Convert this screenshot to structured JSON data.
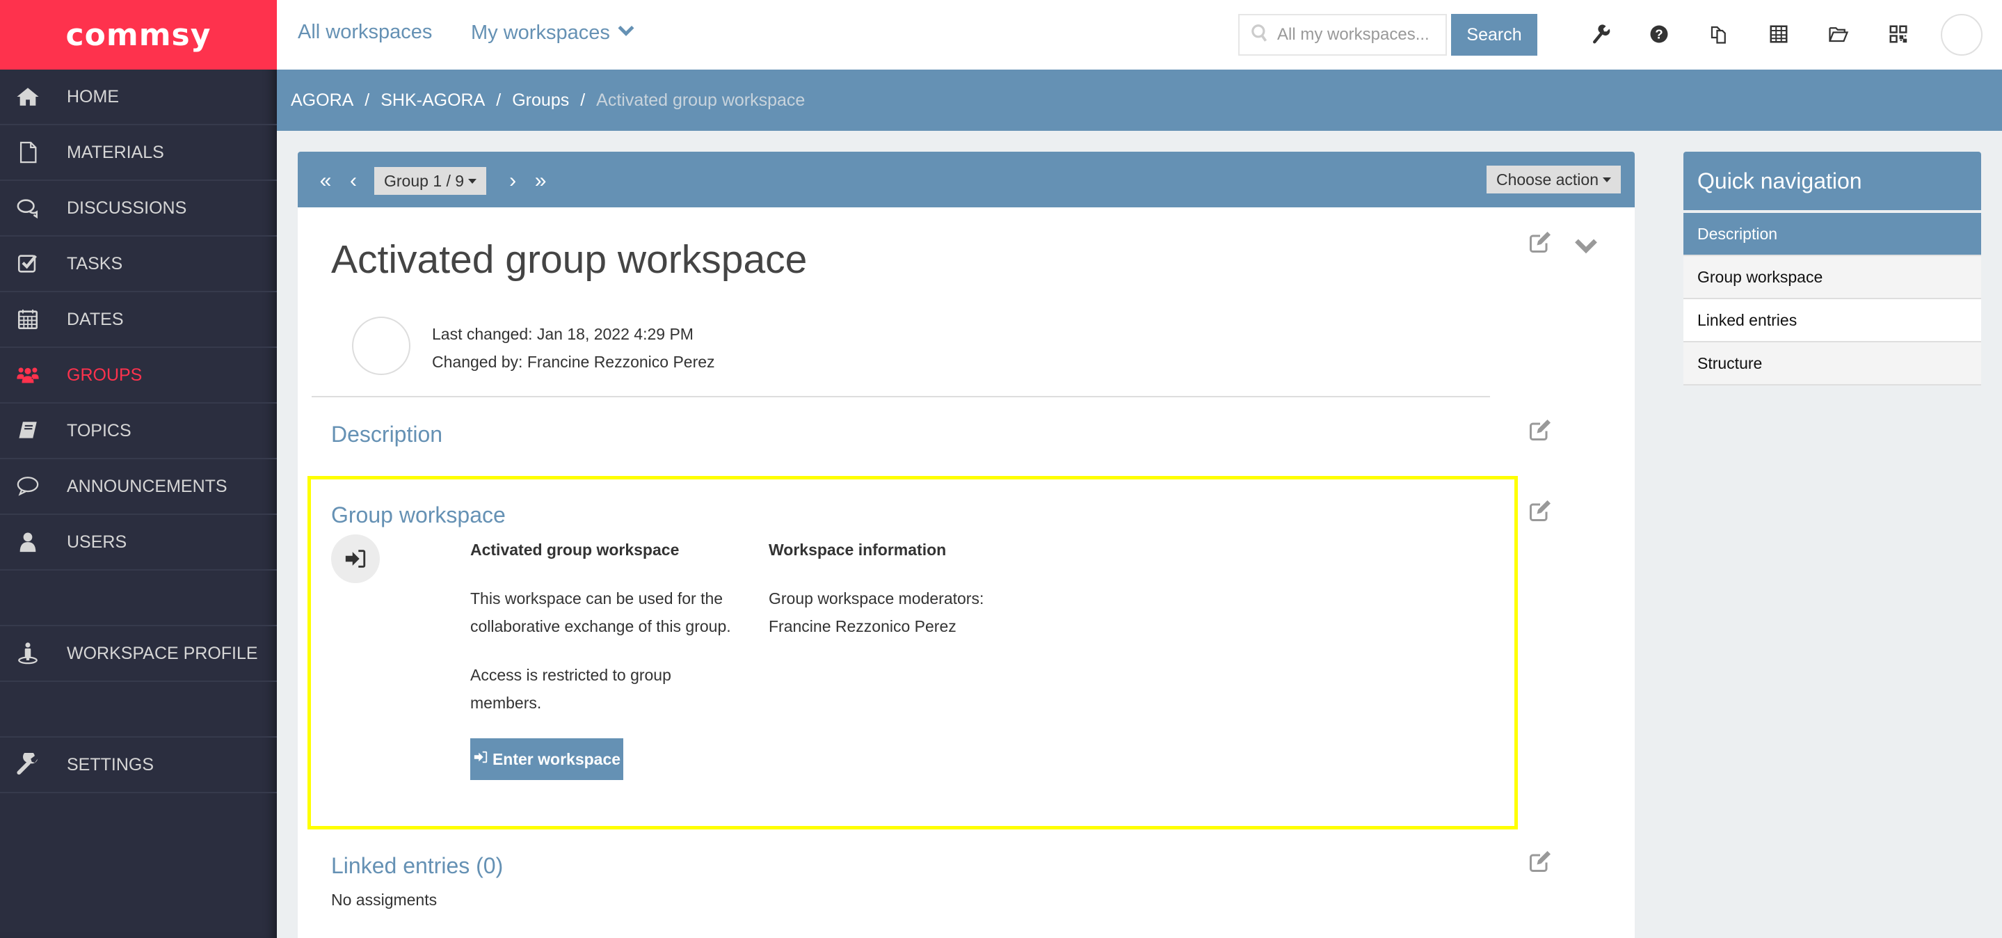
{
  "app": {
    "logo_text": "commsy",
    "brand_color": "#fe324d",
    "accent_color": "#6591b4"
  },
  "sidebar": {
    "items": [
      {
        "label": "HOME",
        "icon": "home-icon",
        "active": false
      },
      {
        "label": "MATERIALS",
        "icon": "file-icon",
        "active": false
      },
      {
        "label": "DISCUSSIONS",
        "icon": "comments-icon",
        "active": false
      },
      {
        "label": "TASKS",
        "icon": "checkbox-icon",
        "active": false
      },
      {
        "label": "DATES",
        "icon": "calendar-icon",
        "active": false
      },
      {
        "label": "GROUPS",
        "icon": "users-icon",
        "active": true
      },
      {
        "label": "TOPICS",
        "icon": "book-icon",
        "active": false
      },
      {
        "label": "ANNOUNCEMENTS",
        "icon": "speech-bubble-icon",
        "active": false
      },
      {
        "label": "USERS",
        "icon": "user-icon",
        "active": false
      },
      {
        "label": "WORKSPACE PROFILE",
        "icon": "street-view-icon",
        "active": false
      },
      {
        "label": "SETTINGS",
        "icon": "wrench-icon",
        "active": false
      }
    ]
  },
  "topbar": {
    "all_workspaces": "All workspaces",
    "my_workspaces": "My workspaces",
    "search_placeholder": "All my workspaces...",
    "search_button": "Search",
    "tools": [
      "wrench-icon",
      "help-icon",
      "copy-icon",
      "table-icon",
      "folder-open-icon",
      "qrcode-icon"
    ]
  },
  "breadcrumb": {
    "items": [
      "AGORA",
      "SHK-AGORA",
      "Groups"
    ],
    "current": "Activated group workspace",
    "separator": "/"
  },
  "toolbar": {
    "pager_label": "Group 1 / 9",
    "first_label": "«",
    "prev_label": "‹",
    "next_label": "›",
    "last_label": "»",
    "action_label": "Choose action"
  },
  "detail": {
    "title": "Activated group workspace",
    "last_changed": "Last changed: Jan 18, 2022 4:29 PM",
    "changed_by": "Changed by: Francine Rezzonico Perez",
    "sections": {
      "description": "Description",
      "group_workspace": "Group workspace",
      "linked_entries": "Linked entries (0)"
    },
    "group_workspace": {
      "col1_heading": "Activated group workspace",
      "col1_text1": "This workspace can be used for the collaborative exchange of this group.",
      "col1_text2": "Access is restricted to group members.",
      "col2_heading": "Workspace information",
      "col2_label": "Group workspace moderators:",
      "col2_value": "Francine Rezzonico Perez",
      "enter_button": "Enter workspace"
    },
    "linked_entries_empty": "No assigments"
  },
  "quicknav": {
    "title": "Quick navigation",
    "items": [
      {
        "label": "Description",
        "active": true
      },
      {
        "label": "Group workspace",
        "active": false
      },
      {
        "label": "Linked entries",
        "active": false
      },
      {
        "label": "Structure",
        "active": false
      }
    ]
  }
}
